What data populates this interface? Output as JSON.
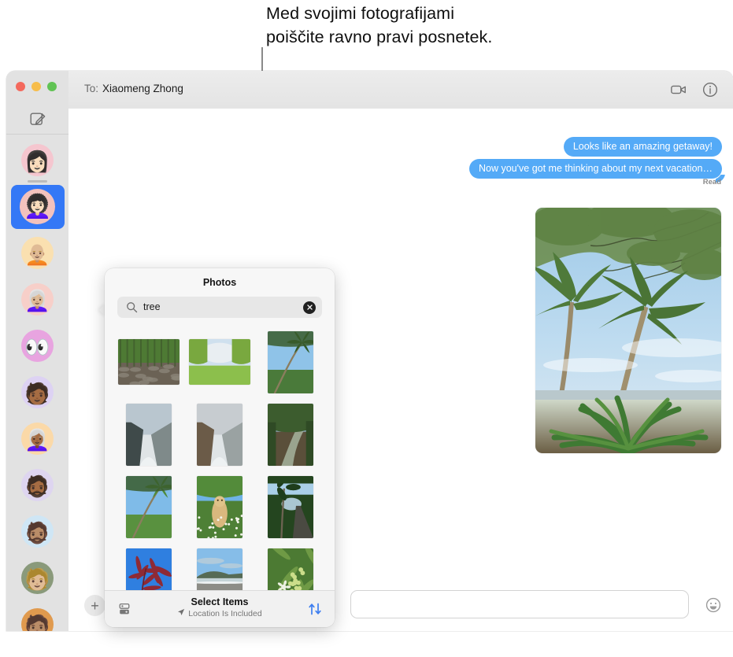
{
  "caption": {
    "text": "Med svojimi fotografijami\npoiščite ravno pravi posnetek."
  },
  "window": {
    "traffic_lights": [
      "close",
      "minimize",
      "zoom"
    ],
    "colors": {
      "close": "#f4695d",
      "minimize": "#f7bd4b",
      "zoom": "#61c354",
      "accent_blue": "#3478f6",
      "bubble_blue": "#54aaf7"
    }
  },
  "sidebar": {
    "compose_icon": "compose-icon",
    "conversations": [
      {
        "name": "conversation-1",
        "avatar": "memoji-woman-dark-hair",
        "bg": "#f5c6cf",
        "glyph": "👩🏻",
        "selected": false
      },
      {
        "name": "conversation-2",
        "avatar": "memoji-woman-bob",
        "bg": "#f3c2bd",
        "glyph": "👩🏻‍🦱",
        "selected": true
      },
      {
        "name": "conversation-3",
        "avatar": "memoji-man-green-cap",
        "bg": "#fae0b0",
        "glyph": "🧑🏼‍🦲",
        "selected": false
      },
      {
        "name": "conversation-4",
        "avatar": "memoji-woman-glasses",
        "bg": "#f7cfc9",
        "glyph": "👩🏼‍🦳",
        "selected": false
      },
      {
        "name": "conversation-5",
        "avatar": "memoji-eyes",
        "bg": "#e8a4e0",
        "glyph": "👀",
        "selected": false
      },
      {
        "name": "conversation-6",
        "avatar": "memoji-man-sunglasses",
        "bg": "#ddd2f3",
        "glyph": "🧑🏾",
        "selected": false
      },
      {
        "name": "conversation-7",
        "avatar": "memoji-woman-gray-hair",
        "bg": "#fbd9a8",
        "glyph": "👩🏾‍🦳",
        "selected": false
      },
      {
        "name": "conversation-8",
        "avatar": "memoji-man-hat-beard",
        "bg": "#ded5f0",
        "glyph": "🧔🏾",
        "selected": false
      },
      {
        "name": "conversation-9",
        "avatar": "memoji-man-beard",
        "bg": "#cfe6f5",
        "glyph": "🧔🏽",
        "selected": false
      },
      {
        "name": "conversation-10",
        "avatar": "photo-avatar-woman",
        "bg": "#8a9a7b",
        "glyph": "🧑🏼",
        "selected": false
      },
      {
        "name": "conversation-11",
        "avatar": "photo-avatar-person",
        "bg": "#e09a4e",
        "glyph": "🧑🏽",
        "selected": false
      }
    ]
  },
  "header": {
    "to_label": "To:",
    "recipient": "Xiaomeng Zhong",
    "facetime_icon": "video-camera-icon",
    "info_icon": "info-circle-icon"
  },
  "conversation": {
    "messages": [
      {
        "text": "Looks like an amazing getaway!",
        "side": "outgoing"
      },
      {
        "text": "Now you've got me thinking about my next vacation…",
        "side": "outgoing"
      }
    ],
    "status": "Read",
    "attachment": "palm-trees-beach-photo"
  },
  "input_bar": {
    "plus_label": "+",
    "message_placeholder": "",
    "message_value": "",
    "emoji_icon": "smiley-icon"
  },
  "photos_popover": {
    "title": "Photos",
    "search": {
      "value": "tree",
      "placeholder": "Search",
      "search_icon": "search-icon",
      "clear_icon": "clear-circle-icon"
    },
    "grid": [
      [
        {
          "name": "photo-forest-rocks",
          "orient": "land"
        },
        {
          "name": "photo-green-meadow-trees",
          "orient": "land"
        },
        {
          "name": "photo-palm-over-water",
          "orient": "port"
        }
      ],
      [
        {
          "name": "photo-coastal-cliffs-1",
          "orient": "port"
        },
        {
          "name": "photo-coastal-cliffs-2",
          "orient": "port"
        },
        {
          "name": "photo-jungle-river",
          "orient": "port"
        }
      ],
      [
        {
          "name": "photo-palms-sky",
          "orient": "port"
        },
        {
          "name": "photo-dog-in-flowers",
          "orient": "port"
        },
        {
          "name": "photo-palm-path-ocean",
          "orient": "port"
        }
      ],
      [
        {
          "name": "photo-red-leaves-sky",
          "orient": "port"
        },
        {
          "name": "photo-black-sand-beach",
          "orient": "port"
        },
        {
          "name": "photo-white-flower-leaves",
          "orient": "port"
        }
      ]
    ],
    "footer": {
      "library_icon": "photo-library-icon",
      "title": "Select Items",
      "subtitle": "Location Is Included",
      "location_icon": "location-arrow-icon",
      "sort_icon": "sort-arrows-icon"
    }
  }
}
